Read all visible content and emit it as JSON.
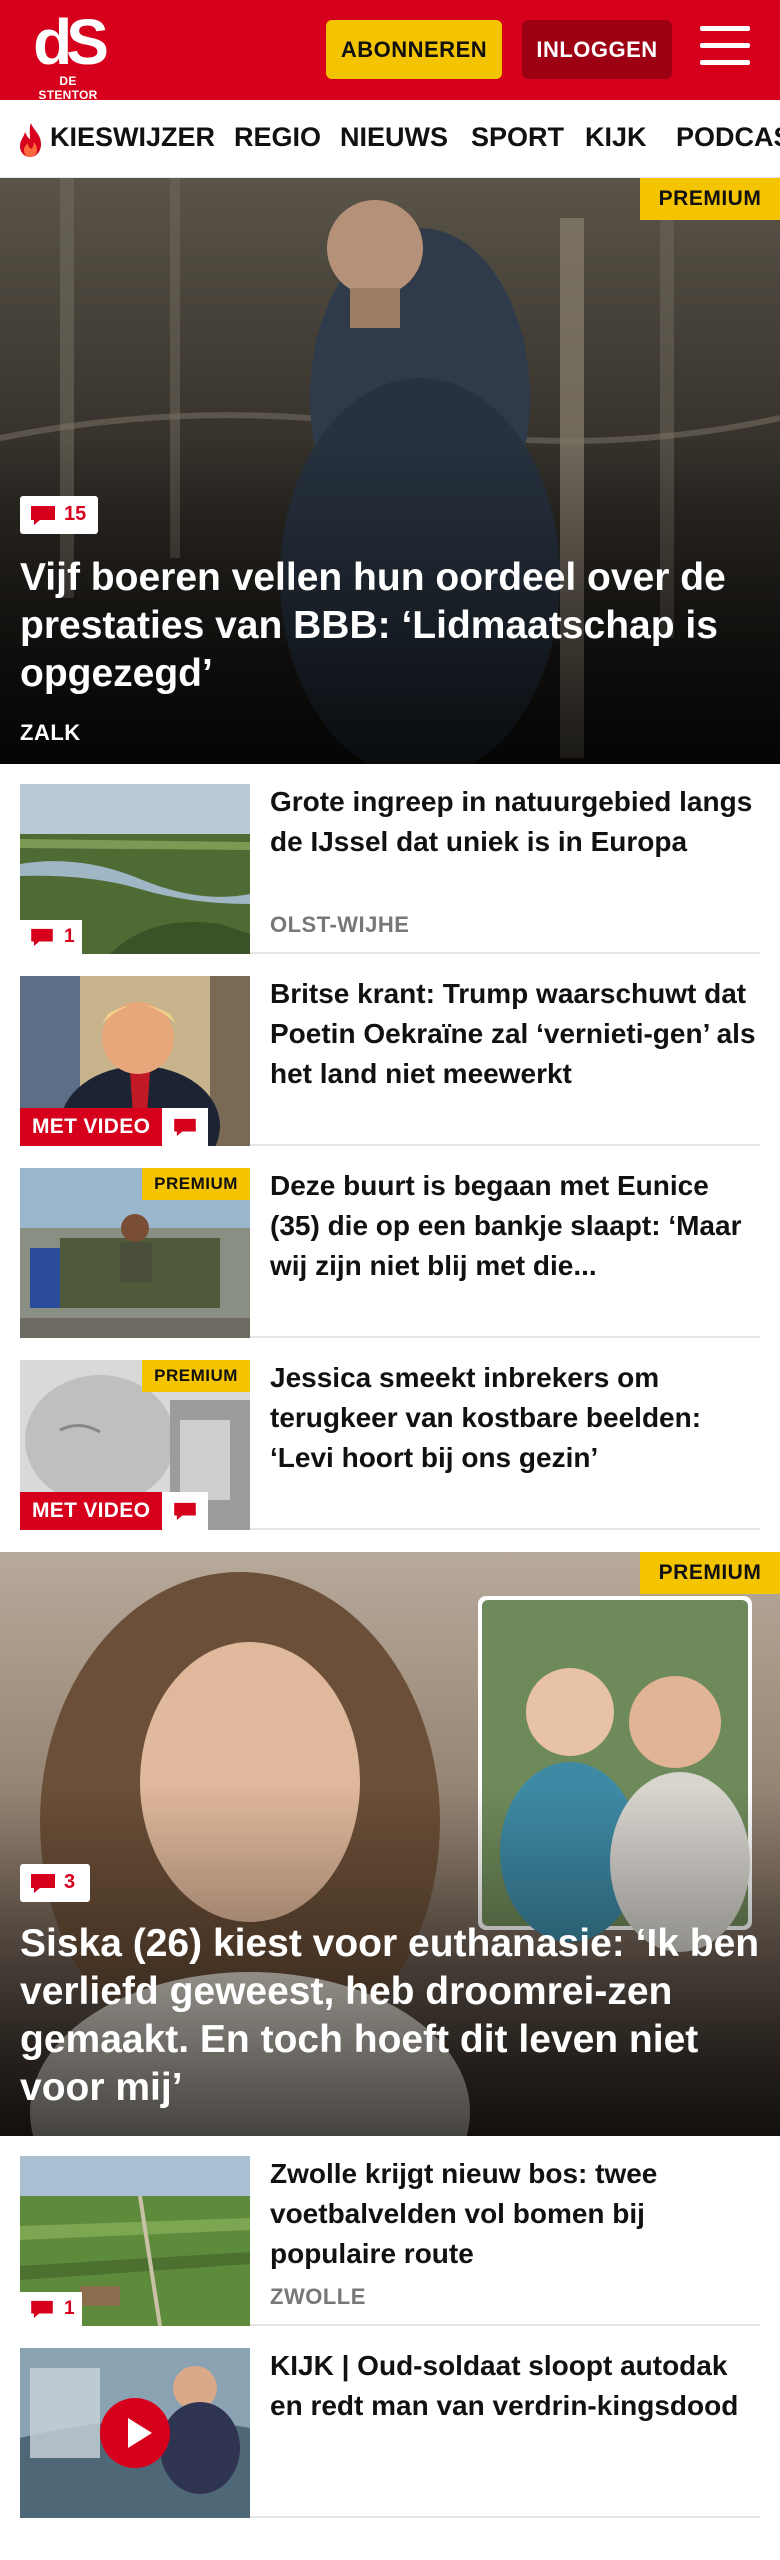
{
  "header": {
    "logo_mark": "dS",
    "logo_sub": "DE STENTOR",
    "subscribe_label": "ABONNEREN",
    "login_label": "INLOGGEN",
    "menu_icon": "hamburger-icon",
    "brand_color": "#d6001c",
    "accent_color": "#f5c400"
  },
  "nav": {
    "items": [
      "KIESWIJZER",
      "REGIO",
      "NIEUWS",
      "SPORT",
      "KIJK",
      "PODCAS"
    ],
    "first_item_icon": "flame-icon"
  },
  "hero1": {
    "premium": "PREMIUM",
    "comments": "15",
    "title": "Vijf boeren vellen hun oordeel over de prestaties van BBB: ‘Lidmaatschap is opgezegd’",
    "location": "ZALK"
  },
  "items1": [
    {
      "title": "Grote ingreep in natuurgebied langs de IJssel dat uniek is in Europa",
      "location": "OLST-WIJHE",
      "comments": "1"
    },
    {
      "title": "Britse krant: Trump waarschuwt dat Poetin Oekraïne zal ‘vernieti-gen’ als het land niet meewerkt",
      "video_label": "MET VIDEO"
    },
    {
      "title": "Deze buurt is begaan met Eunice (35) die op een bankje slaapt: ‘Maar wij zijn niet blij met die...",
      "premium": "PREMIUM"
    },
    {
      "title": "Jessica smeekt inbrekers om terugkeer van kostbare beelden: ‘Levi hoort bij ons gezin’",
      "premium": "PREMIUM",
      "video_label": "MET VIDEO"
    }
  ],
  "hero2": {
    "premium": "PREMIUM",
    "comments": "3",
    "title": "Siska (26) kiest voor euthanasie: ‘Ik ben verliefd geweest, heb droomrei-zen gemaakt. En toch hoeft dit leven niet voor mij’"
  },
  "items2": [
    {
      "title": "Zwolle krijgt nieuw bos: twee voetbalvelden vol bomen bij populaire route",
      "location": "ZWOLLE",
      "comments": "1"
    },
    {
      "title": "KIJK | Oud-soldaat sloopt autodak en redt man van verdrin-kingsdood"
    }
  ]
}
